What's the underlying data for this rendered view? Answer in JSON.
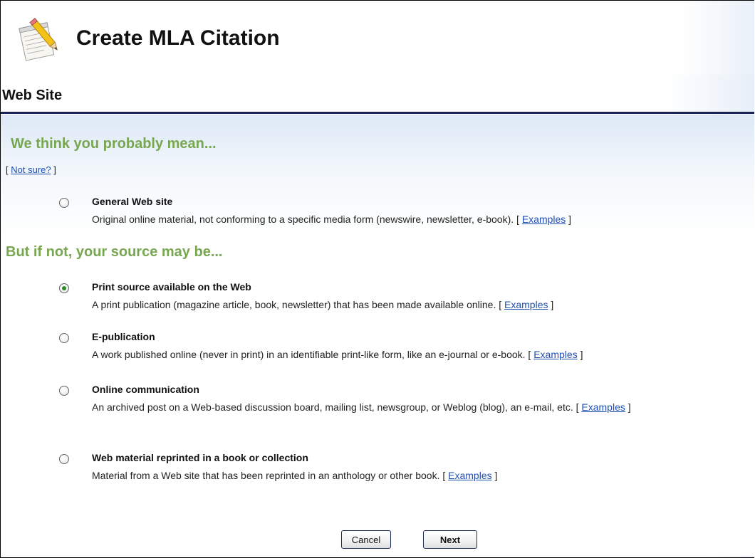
{
  "header": {
    "title": "Create MLA Citation",
    "logo_icon": "notepad-pencil-icon"
  },
  "section": {
    "title": "Web Site"
  },
  "suggestion": {
    "heading": "We think you probably mean...",
    "not_sure_open": "[ ",
    "not_sure_link": "Not sure?",
    "not_sure_close": " ]"
  },
  "alternatives": {
    "heading": "But if not, your source may be..."
  },
  "options": [
    {
      "title": "General Web site",
      "description": "Original online material, not conforming to a specific media form (newswire, newsletter, e-book).",
      "examples_label": "Examples",
      "checked": false
    },
    {
      "title": "Print source available on the Web",
      "description": "A print publication (magazine article, book, newsletter) that has been made available online.",
      "examples_label": "Examples",
      "checked": true
    },
    {
      "title": "E-publication",
      "description": "A work published online (never in print) in an identifiable print-like form, like an e-journal or e-book.",
      "examples_label": "Examples",
      "checked": false
    },
    {
      "title": "Online communication",
      "description": "An archived post on a Web-based discussion board, mailing list, newsgroup, or Weblog (blog), an e-mail, etc.",
      "examples_label": "Examples",
      "checked": false
    },
    {
      "title": "Web material reprinted in a book or collection",
      "description": "Material from a Web site that has been reprinted in an anthology or other book.",
      "examples_label": "Examples",
      "checked": false
    }
  ],
  "buttons": {
    "cancel": "Cancel",
    "next": "Next"
  },
  "colors": {
    "green_heading": "#77a750",
    "link": "#1f4fb3",
    "section_rule": "#1a2454",
    "selected_radio": "#2b8a1f"
  }
}
